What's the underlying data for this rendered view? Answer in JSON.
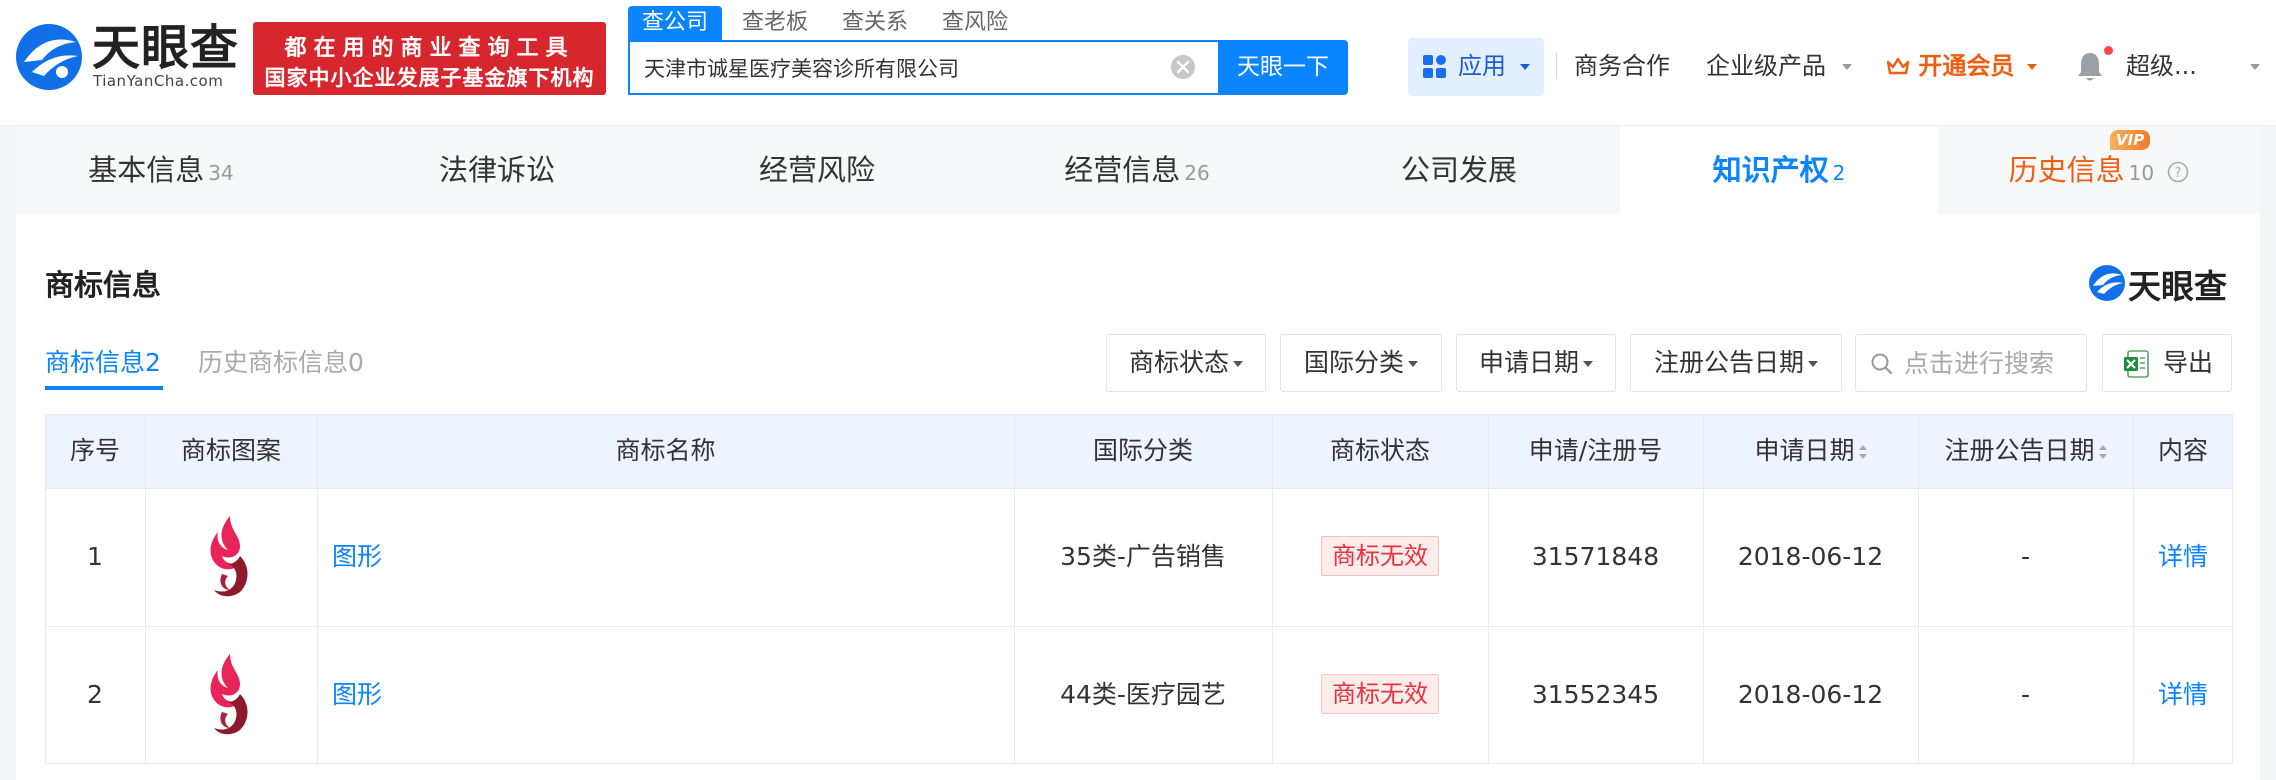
{
  "header": {
    "logo_text": "天眼查",
    "logo_sub": "TianYanCha.com",
    "slogan_line1": "都在用的商业查询工具",
    "slogan_line2": "国家中小企业发展子基金旗下机构",
    "search_tabs": [
      "查公司",
      "查老板",
      "查关系",
      "查风险"
    ],
    "search_value": "天津市诚星医疗美容诊所有限公司",
    "search_button": "天眼一下",
    "app_button": "应用",
    "nav_business": "商务合作",
    "nav_enterprise": "企业级产品",
    "vip_button": "开通会员",
    "user_name": "超级..."
  },
  "page_tabs": [
    {
      "label": "基本信息",
      "count": "34"
    },
    {
      "label": "法律诉讼",
      "count": ""
    },
    {
      "label": "经营风险",
      "count": ""
    },
    {
      "label": "经营信息",
      "count": "26"
    },
    {
      "label": "公司发展",
      "count": ""
    },
    {
      "label": "知识产权",
      "count": "2"
    },
    {
      "label": "历史信息",
      "count": "10",
      "badge": "VIP"
    }
  ],
  "section": {
    "title": "商标信息",
    "brand_text": "天眼查",
    "subtabs": [
      {
        "label": "商标信息",
        "count": "2"
      },
      {
        "label": "历史商标信息",
        "count": "0"
      }
    ],
    "filters": [
      "商标状态",
      "国际分类",
      "申请日期",
      "注册公告日期"
    ],
    "search_placeholder": "点击进行搜索",
    "export_label": "导出"
  },
  "table": {
    "columns": [
      "序号",
      "商标图案",
      "商标名称",
      "国际分类",
      "商标状态",
      "申请/注册号",
      "申请日期",
      "注册公告日期",
      "内容"
    ],
    "rows": [
      {
        "index": "1",
        "name": "图形",
        "category": "35类-广告销售",
        "status": "商标无效",
        "reg_no": "31571848",
        "apply_date": "2018-06-12",
        "notice_date": "-",
        "detail": "详情"
      },
      {
        "index": "2",
        "name": "图形",
        "category": "44类-医疗园艺",
        "status": "商标无效",
        "reg_no": "31552345",
        "apply_date": "2018-06-12",
        "notice_date": "-",
        "detail": "详情"
      }
    ]
  },
  "colors": {
    "brand_blue": "#0a84ff",
    "slogan_red": "#d8262e",
    "vip_orange": "#f05e13",
    "status_red": "#e8323c",
    "trademark_pink": "#e8245a",
    "trademark_maroon": "#8c1a2a"
  }
}
